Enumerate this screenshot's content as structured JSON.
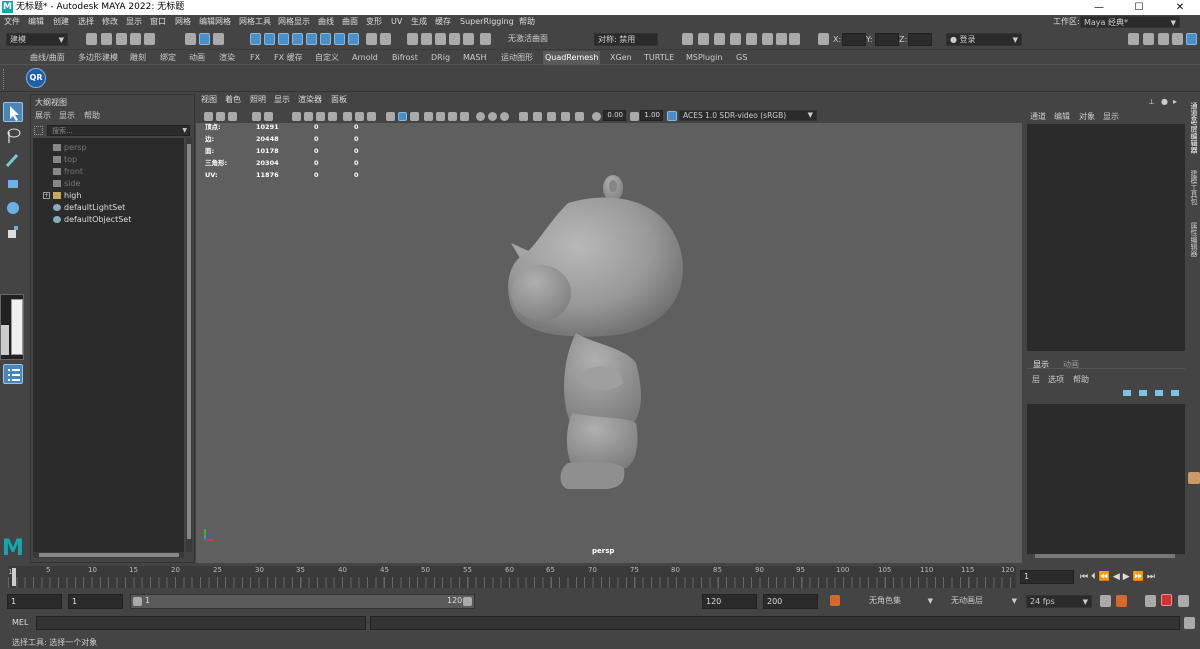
{
  "titlebar": {
    "logo": "M",
    "title": "无标题* - Autodesk MAYA 2022: 无标题",
    "minimize": "—",
    "maximize": "☐",
    "close": "✕"
  },
  "menu": [
    "文件",
    "编辑",
    "创建",
    "选择",
    "修改",
    "显示",
    "窗口",
    "网格",
    "编辑网格",
    "网格工具",
    "网格显示",
    "曲线",
    "曲面",
    "变形",
    "UV",
    "生成",
    "缓存",
    "SuperRigging",
    "帮助"
  ],
  "workspace": {
    "label": "工作区:",
    "value": "Maya 经典*"
  },
  "toolbar": {
    "mode": "建模",
    "live_surface": "无激活曲面",
    "symmetry": "对称: 禁用",
    "x_label": "X:",
    "y_label": "Y:",
    "z_label": "Z:",
    "login": "登录"
  },
  "shelf_tabs": [
    "曲线/曲面",
    "多边形建模",
    "雕刻",
    "绑定",
    "动画",
    "渲染",
    "FX",
    "FX 缓存",
    "自定义",
    "Arnold",
    "Bifrost",
    "DRig",
    "MASH",
    "运动图形",
    "QuadRemesh",
    "XGen",
    "TURTLE",
    "MSPlugin",
    "GS"
  ],
  "shelf_active": "QuadRemesh",
  "shelf_button": "QR",
  "outliner": {
    "title": "大纲视图",
    "menu": [
      "展示",
      "显示",
      "帮助"
    ],
    "search_placeholder": "搜索...",
    "items": [
      {
        "name": "persp",
        "dim": true
      },
      {
        "name": "top",
        "dim": true
      },
      {
        "name": "front",
        "dim": true
      },
      {
        "name": "side",
        "dim": true
      },
      {
        "name": "high",
        "dim": false
      },
      {
        "name": "defaultLightSet",
        "dim": false
      },
      {
        "name": "defaultObjectSet",
        "dim": false
      }
    ]
  },
  "viewport": {
    "menu": [
      "视图",
      "着色",
      "照明",
      "显示",
      "渲染器",
      "面板"
    ],
    "exposure": "0.00",
    "gamma": "1.00",
    "colorspace": "ACES 1.0 SDR-video (sRGB)",
    "camera": "persp",
    "hud": [
      {
        "label": "顶点:",
        "values": [
          "10291",
          "0",
          "0"
        ]
      },
      {
        "label": "边:",
        "values": [
          "20448",
          "0",
          "0"
        ]
      },
      {
        "label": "面:",
        "values": [
          "10178",
          "0",
          "0"
        ]
      },
      {
        "label": "三角形:",
        "values": [
          "20304",
          "0",
          "0"
        ]
      },
      {
        "label": "UV:",
        "values": [
          "11876",
          "0",
          "0"
        ]
      }
    ]
  },
  "channelbox": {
    "menu": [
      "通道",
      "编辑",
      "对象",
      "显示"
    ],
    "layer_tabs": [
      "显示",
      "动画"
    ],
    "layer_menu": [
      "层",
      "选项",
      "帮助"
    ]
  },
  "side_tabs": [
    "通道盒/层编辑器",
    "建模工具包",
    "属性编辑器"
  ],
  "timeline": {
    "ticks": [
      "1",
      "5",
      "10",
      "15",
      "20",
      "25",
      "30",
      "35",
      "40",
      "45",
      "50",
      "55",
      "60",
      "65",
      "70",
      "75",
      "80",
      "85",
      "90",
      "95",
      "100",
      "105",
      "110",
      "115",
      "120"
    ],
    "current_frame": "1"
  },
  "range": {
    "start": "1",
    "playback_start": "1",
    "slider_start": "1",
    "slider_end": "120",
    "playback_end": "120",
    "end": "200",
    "character_set": "无角色集",
    "anim_layer": "无动画层",
    "fps": "24 fps"
  },
  "cmd": {
    "lang": "MEL"
  },
  "help_line": "选择工具: 选择一个对象",
  "colors": {
    "accent": "#4b8fc8",
    "maya_teal": "#15a6b0"
  }
}
